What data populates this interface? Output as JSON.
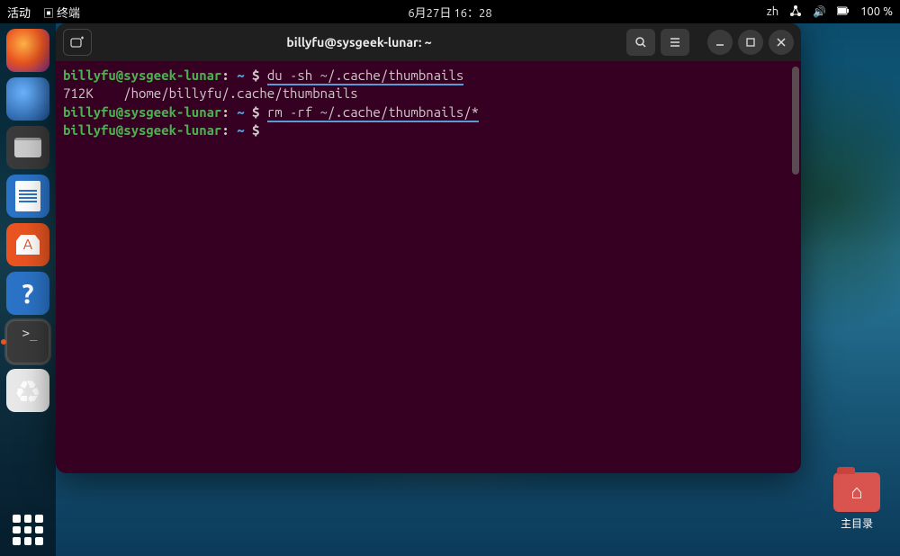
{
  "topbar": {
    "activities": "活动",
    "app_indicator": "终端",
    "datetime": "6月27日 16：28",
    "input_method": "zh",
    "battery": "100 %"
  },
  "dock": {
    "home_label": "主目录"
  },
  "terminal": {
    "title": "billyfu@sysgeek-lunar: ~",
    "lines": [
      {
        "user": "billyfu@sysgeek-lunar",
        "path": "~",
        "cmd": "du -sh ~/.cache/thumbnails",
        "underline": true
      },
      {
        "raw": "712K    /home/billyfu/.cache/thumbnails"
      },
      {
        "user": "billyfu@sysgeek-lunar",
        "path": "~",
        "cmd": "rm -rf ~/.cache/thumbnails/*",
        "underline": true
      },
      {
        "user": "billyfu@sysgeek-lunar",
        "path": "~",
        "cmd": ""
      }
    ]
  }
}
